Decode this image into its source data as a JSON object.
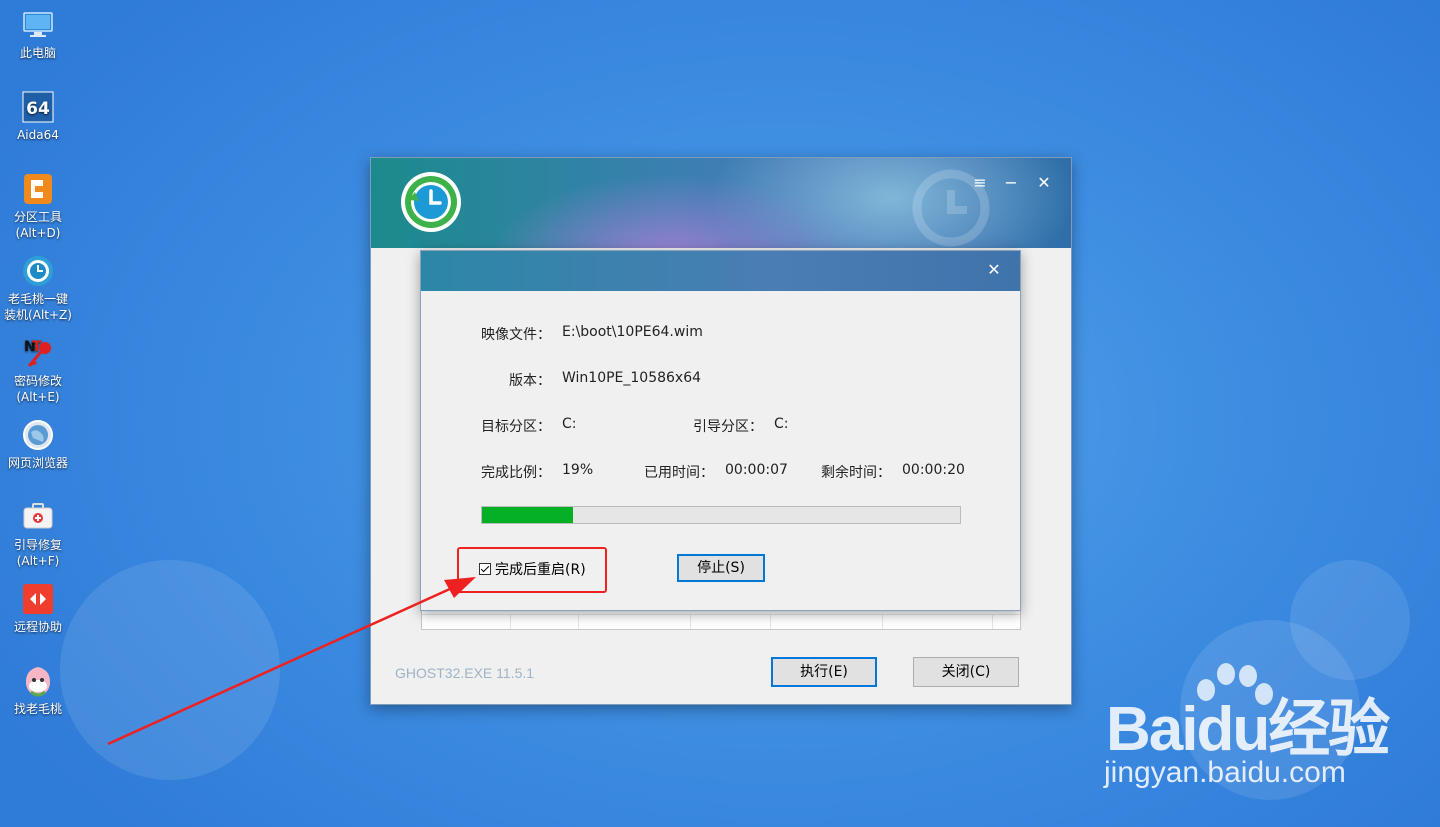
{
  "desktop": {
    "icons": [
      {
        "label": "此电脑",
        "icon": "computer-icon"
      },
      {
        "label": "Aida64",
        "icon": "aida64-icon"
      },
      {
        "label": "分区工具\n(Alt+D)",
        "icon": "partition-tool-icon"
      },
      {
        "label": "老毛桃一键\n装机(Alt+Z)",
        "icon": "one-click-install-icon"
      },
      {
        "label": "密码修改\n(Alt+E)",
        "icon": "password-change-icon"
      },
      {
        "label": "网页浏览器",
        "icon": "web-browser-icon"
      },
      {
        "label": "引导修复\n(Alt+F)",
        "icon": "boot-repair-icon"
      },
      {
        "label": "远程协助",
        "icon": "remote-assist-icon"
      },
      {
        "label": "找老毛桃",
        "icon": "find-laomaotao-icon"
      }
    ]
  },
  "main_window": {
    "version": "GHOST32.EXE 11.5.1",
    "execute_label": "执行(E)",
    "close_label": "关闭(C)",
    "title_buttons": {
      "menu": "≡",
      "minimize": "−",
      "close": "✕"
    }
  },
  "progress_dialog": {
    "image_file_label": "映像文件：",
    "image_file_value": "E:\\boot\\10PE64.wim",
    "version_label": "版本：",
    "version_value": "Win10PE_10586x64",
    "target_partition_label": "目标分区：",
    "target_partition_value": "C:",
    "boot_partition_label": "引导分区：",
    "boot_partition_value": "C:",
    "completion_label": "完成比例：",
    "completion_value": "19%",
    "progress_fraction": 0.19,
    "elapsed_label": "已用时间：",
    "elapsed_value": "00:00:07",
    "remaining_label": "剩余时间：",
    "remaining_value": "00:00:20",
    "reboot_checkbox_label": "完成后重启(R)",
    "reboot_checked": true,
    "stop_label": "停止(S)",
    "close_symbol": "✕"
  },
  "watermark": {
    "brand": "Baidu经验",
    "url": "jingyan.baidu.com"
  },
  "colors": {
    "desktop_blue": "#3f8fe3",
    "progress_green": "#06b025",
    "highlight_red": "#ee2020",
    "default_button_border": "#0078d7"
  }
}
